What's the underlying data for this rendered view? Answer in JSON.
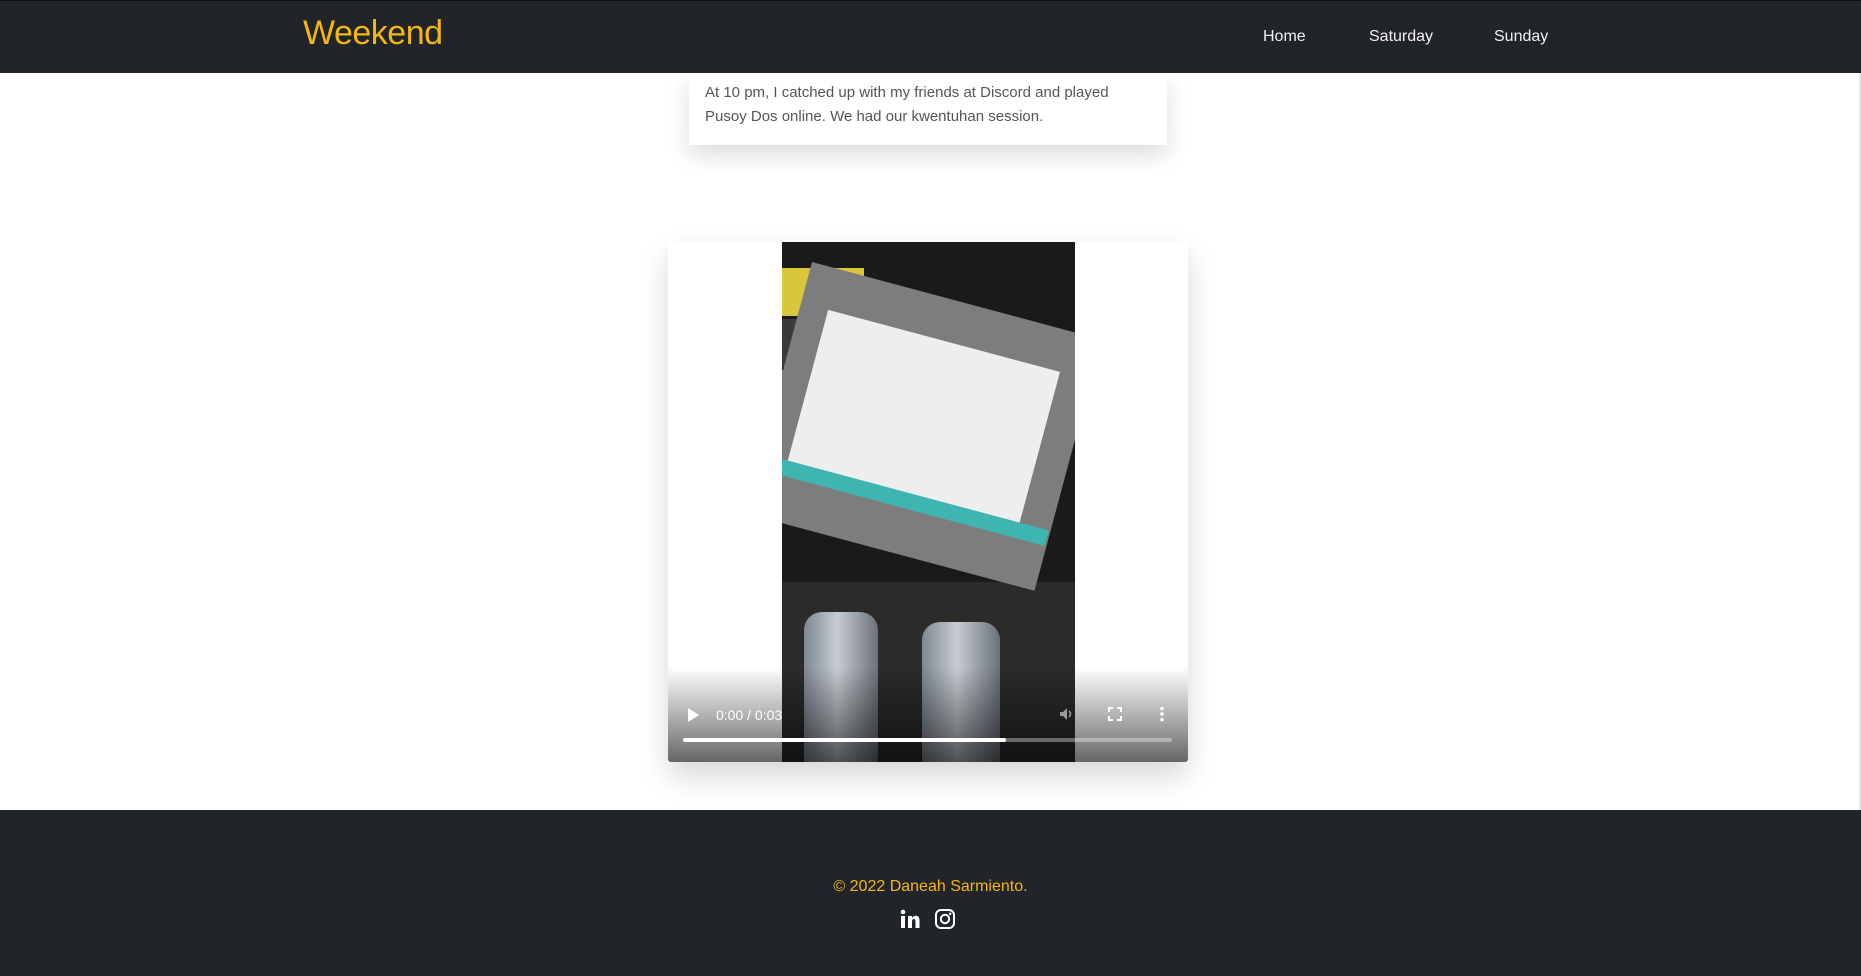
{
  "navbar": {
    "brand": "Weekend",
    "links": [
      "Home",
      "Saturday",
      "Sunday"
    ]
  },
  "card": {
    "text": "At 10 pm, I catched up with my friends at Discord and played Pusoy Dos online. We had our kwentuhan session."
  },
  "video": {
    "time": "0:00 / 0:03",
    "progress": 0.66,
    "icons": [
      "play-icon",
      "mute-icon",
      "fullscreen-icon",
      "more-options-icon"
    ]
  },
  "footer": {
    "copyright": "© 2022 Daneah Sarmiento.",
    "social_icons": [
      "linkedin-icon",
      "instagram-icon"
    ]
  },
  "colors": {
    "nav_bg": "#212529",
    "brand_accent": "#f5b614"
  }
}
